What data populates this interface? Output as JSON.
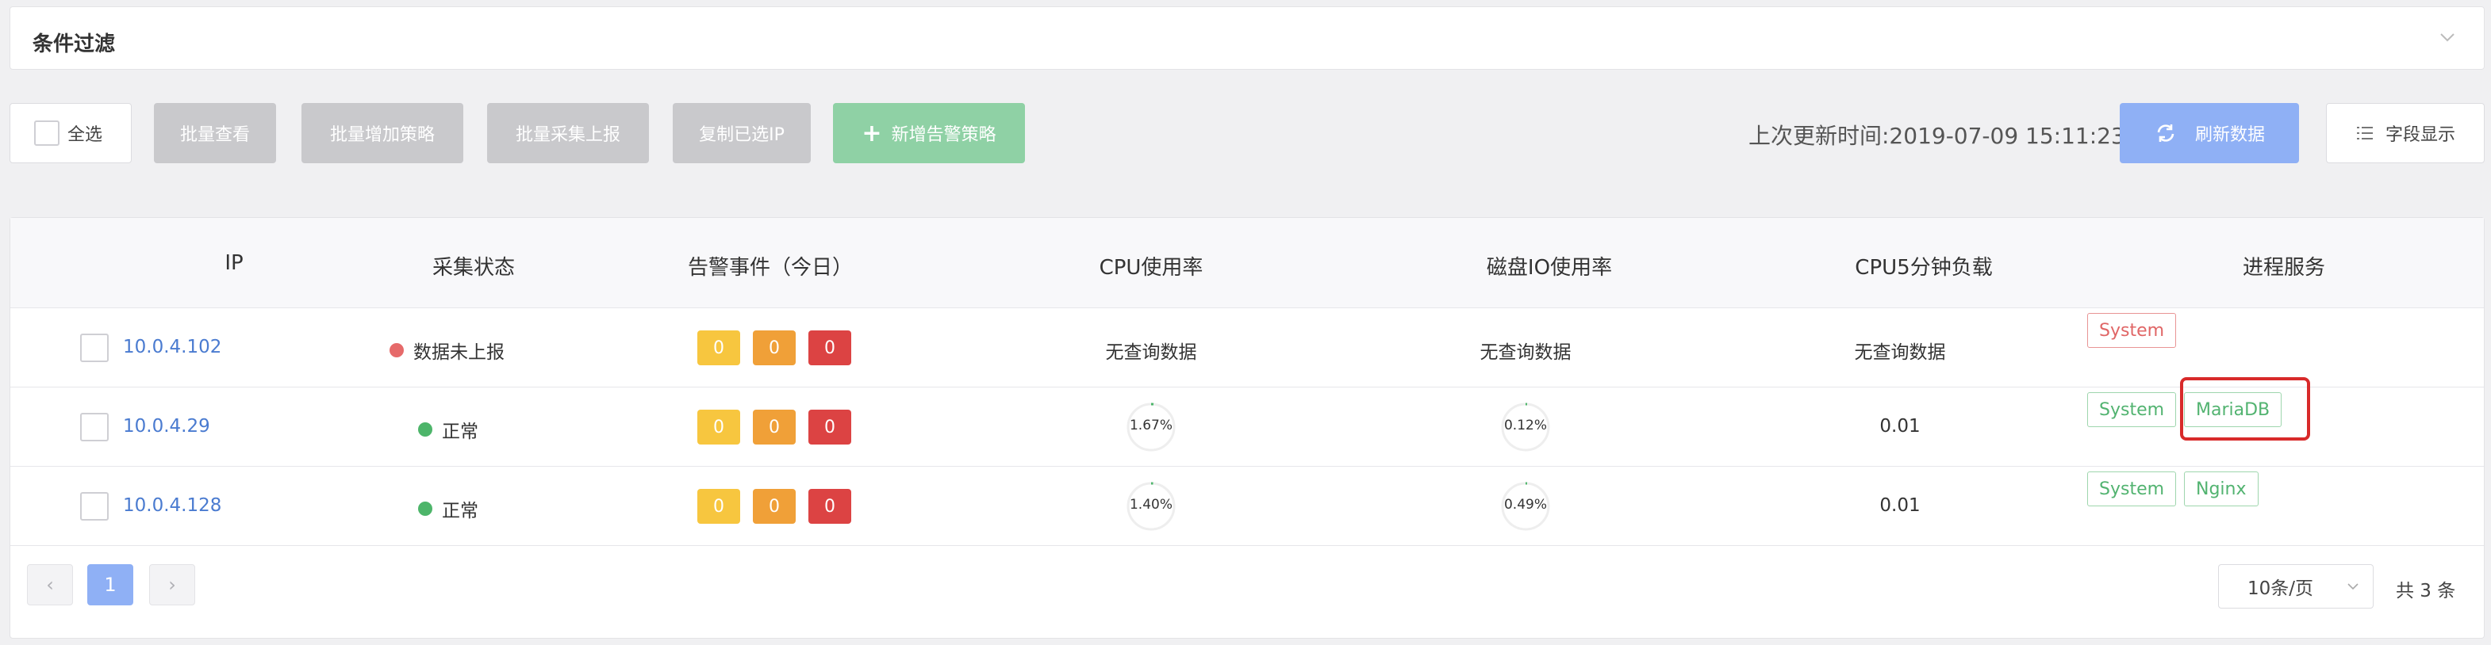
{
  "filter": {
    "title": "条件过滤"
  },
  "toolbar": {
    "select_all": "全选",
    "batch_view": "批量查看",
    "batch_add_policy": "批量增加策略",
    "batch_collect_report": "批量采集上报",
    "copy_selected_ip": "复制已选IP",
    "add_alert_policy": "新增告警策略",
    "last_update": "上次更新时间:2019-07-09 15:11:23",
    "refresh": "刷新数据",
    "field_display": "字段显示"
  },
  "table": {
    "headers": [
      "IP",
      "采集状态",
      "告警事件（今日）",
      "CPU使用率",
      "磁盘IO使用率",
      "CPU5分钟负载",
      "进程服务"
    ],
    "rows": [
      {
        "ip": "10.0.4.102",
        "status": "数据未上报",
        "status_color": "#e66a6a",
        "alarms": [
          "0",
          "0",
          "0"
        ],
        "cpu": "无查询数据",
        "disk_io": "无查询数据",
        "load5": "无查询数据",
        "services": [
          {
            "name": "System",
            "state": "error"
          }
        ]
      },
      {
        "ip": "10.0.4.29",
        "status": "正常",
        "status_color": "#4db56a",
        "alarms": [
          "0",
          "0",
          "0"
        ],
        "cpu": "1.67%",
        "cpu_value": 1.67,
        "disk_io": "0.12%",
        "disk_io_value": 0.12,
        "load5": "0.01",
        "services": [
          {
            "name": "System",
            "state": "ok"
          },
          {
            "name": "MariaDB",
            "state": "ok"
          }
        ]
      },
      {
        "ip": "10.0.4.128",
        "status": "正常",
        "status_color": "#4db56a",
        "alarms": [
          "0",
          "0",
          "0"
        ],
        "cpu": "1.40%",
        "cpu_value": 1.4,
        "disk_io": "0.49%",
        "disk_io_value": 0.49,
        "load5": "0.01",
        "services": [
          {
            "name": "System",
            "state": "ok"
          },
          {
            "name": "Nginx",
            "state": "ok"
          }
        ]
      }
    ]
  },
  "pagination": {
    "current": "1",
    "page_size": "10条/页",
    "total": "共 3 条"
  },
  "colors": {
    "alarm_yellow": "#f7c63f",
    "alarm_orange": "#f0a038",
    "alarm_red": "#dc4343",
    "accent_blue": "#8fb0f5",
    "accent_green": "#8fd1a5"
  }
}
